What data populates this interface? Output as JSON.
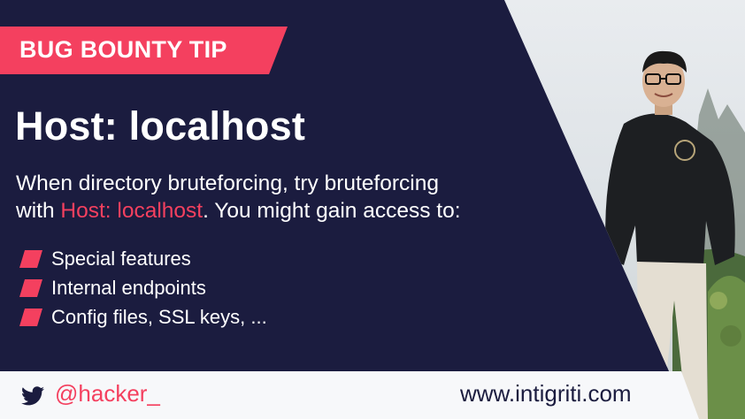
{
  "banner": {
    "label": "BUG BOUNTY TIP"
  },
  "headline": "Host: localhost",
  "description": {
    "line1": "When directory bruteforcing, try bruteforcing",
    "line2_prefix": "with ",
    "line2_highlight": "Host: localhost",
    "line2_suffix": ".  You might gain access to:"
  },
  "bullets": [
    {
      "label": "Special features"
    },
    {
      "label": "Internal endpoints"
    },
    {
      "label": "Config files, SSL keys, ..."
    }
  ],
  "footer": {
    "handle": "@hacker_",
    "website": "www.intigriti.com",
    "social_icon": "twitter-icon"
  },
  "colors": {
    "background": "#1b1c3f",
    "accent": "#f4405f",
    "footer_bg": "#f7f8fa",
    "text": "#ffffff"
  }
}
